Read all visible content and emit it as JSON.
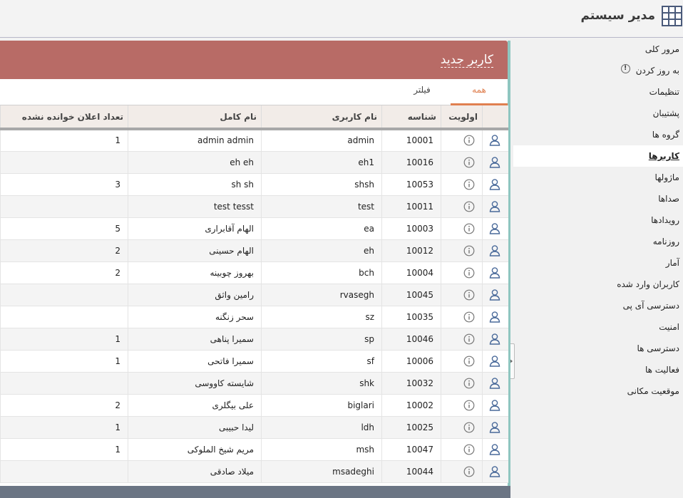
{
  "app": {
    "title": "مدیر سیستم"
  },
  "sidebar": {
    "items": [
      {
        "label": "مرور کلی",
        "active": false
      },
      {
        "label": "به روز کردن",
        "active": false,
        "badge": "!"
      },
      {
        "label": "تنظیمات",
        "active": false
      },
      {
        "label": "پشتیبان",
        "active": false
      },
      {
        "label": "گروه ها",
        "active": false
      },
      {
        "label": "کاربرها",
        "active": true
      },
      {
        "label": "ماژولها",
        "active": false
      },
      {
        "label": "صداها",
        "active": false
      },
      {
        "label": "رویدادها",
        "active": false
      },
      {
        "label": "روزنامه",
        "active": false
      },
      {
        "label": "آمار",
        "active": false
      },
      {
        "label": "کاربران وارد شده",
        "active": false
      },
      {
        "label": "دسترسی آی پی",
        "active": false
      },
      {
        "label": "امنیت",
        "active": false
      },
      {
        "label": "دسترسی ها",
        "active": false
      },
      {
        "label": "فعالیت ها",
        "active": false
      },
      {
        "label": "موقعیت مکانی",
        "active": false
      }
    ]
  },
  "main": {
    "new_user_label": "کاربر جدید",
    "tabs": [
      {
        "label": "همه",
        "active": true
      },
      {
        "label": "فیلتر",
        "active": false
      }
    ],
    "columns": {
      "priority": "اولویت",
      "id": "شناسه",
      "username": "نام کاربری",
      "fullname": "نام کامل",
      "unread": "تعداد اعلان خوانده نشده"
    },
    "rows": [
      {
        "id": "10001",
        "username": "admin",
        "fullname": "admin admin",
        "unread": "1"
      },
      {
        "id": "10016",
        "username": "eh1",
        "fullname": "eh eh",
        "unread": ""
      },
      {
        "id": "10053",
        "username": "shsh",
        "fullname": "sh sh",
        "unread": "3"
      },
      {
        "id": "10011",
        "username": "test",
        "fullname": "test tesst",
        "unread": ""
      },
      {
        "id": "10003",
        "username": "ea",
        "fullname": "الهام آقابراری",
        "unread": "5"
      },
      {
        "id": "10012",
        "username": "eh",
        "fullname": "الهام حسینی",
        "unread": "2"
      },
      {
        "id": "10004",
        "username": "bch",
        "fullname": "بهروز چوبینه",
        "unread": "2"
      },
      {
        "id": "10045",
        "username": "rvasegh",
        "fullname": "رامین واثق",
        "unread": ""
      },
      {
        "id": "10035",
        "username": "sz",
        "fullname": "سحر زنگنه",
        "unread": ""
      },
      {
        "id": "10046",
        "username": "sp",
        "fullname": "سمیرا پناهی",
        "unread": "1"
      },
      {
        "id": "10006",
        "username": "sf",
        "fullname": "سمیرا فاتحی",
        "unread": "1"
      },
      {
        "id": "10032",
        "username": "shk",
        "fullname": "شایسته کاووسی",
        "unread": ""
      },
      {
        "id": "10002",
        "username": "biglari",
        "fullname": "علی بیگلری",
        "unread": "2"
      },
      {
        "id": "10025",
        "username": "ldh",
        "fullname": "لیدا حبیبی",
        "unread": "1"
      },
      {
        "id": "10047",
        "username": "msh",
        "fullname": "مریم شیخ الملوکی",
        "unread": "1"
      },
      {
        "id": "10044",
        "username": "msadeghi",
        "fullname": "میلاد صادقی",
        "unread": ""
      }
    ]
  },
  "colors": {
    "header_bar": "#b86b66",
    "active_tab": "#e08050",
    "panel_border": "#8fc6c0",
    "footer_bar": "#6b7584"
  },
  "icons": {
    "logo": "grid-logo-icon",
    "row_user": "user-icon",
    "row_info": "info-icon",
    "collapse": "chevron-right-icon"
  }
}
